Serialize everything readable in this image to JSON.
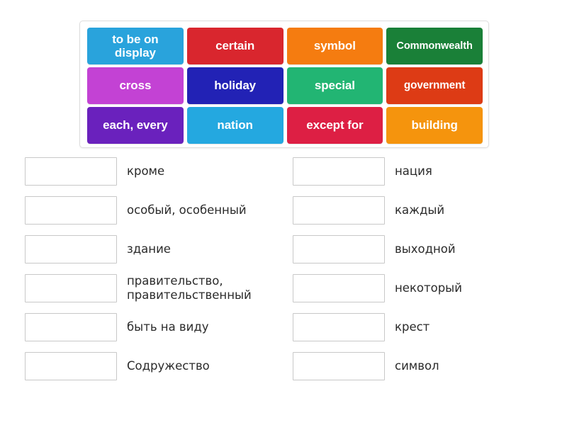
{
  "tile_bank": {
    "name": "word-tile-bank",
    "rows": [
      [
        {
          "label": "to be on\ndisplay",
          "color": "#29a3dc",
          "size": "normal"
        },
        {
          "label": "certain",
          "color": "#d9262e",
          "size": "normal"
        },
        {
          "label": "symbol",
          "color": "#f57c10",
          "size": "normal"
        },
        {
          "label": "Commonwealth",
          "color": "#1a8038",
          "size": "tiny"
        }
      ],
      [
        {
          "label": "cross",
          "color": "#c342d4",
          "size": "normal"
        },
        {
          "label": "holiday",
          "color": "#2222b5",
          "size": "normal"
        },
        {
          "label": "special",
          "color": "#22b573",
          "size": "normal"
        },
        {
          "label": "government",
          "color": "#dd3b15",
          "size": "small"
        }
      ],
      [
        {
          "label": "each, every",
          "color": "#6a21bd",
          "size": "normal"
        },
        {
          "label": "nation",
          "color": "#24a8e0",
          "size": "normal"
        },
        {
          "label": "except for",
          "color": "#dd1f44",
          "size": "normal"
        },
        {
          "label": "building",
          "color": "#f5940d",
          "size": "normal"
        }
      ]
    ]
  },
  "answers": {
    "left_column": [
      {
        "box_value": "",
        "label": "кроме"
      },
      {
        "box_value": "",
        "label": "особый, особенный"
      },
      {
        "box_value": "",
        "label": "здание"
      },
      {
        "box_value": "",
        "label": "правительство,\nправительственный"
      },
      {
        "box_value": "",
        "label": "быть на виду"
      },
      {
        "box_value": "",
        "label": "Содружество"
      }
    ],
    "right_column": [
      {
        "box_value": "",
        "label": "нация"
      },
      {
        "box_value": "",
        "label": "каждый"
      },
      {
        "box_value": "",
        "label": "выходной"
      },
      {
        "box_value": "",
        "label": "некоторый"
      },
      {
        "box_value": "",
        "label": "крест"
      },
      {
        "box_value": "",
        "label": "символ"
      }
    ]
  }
}
